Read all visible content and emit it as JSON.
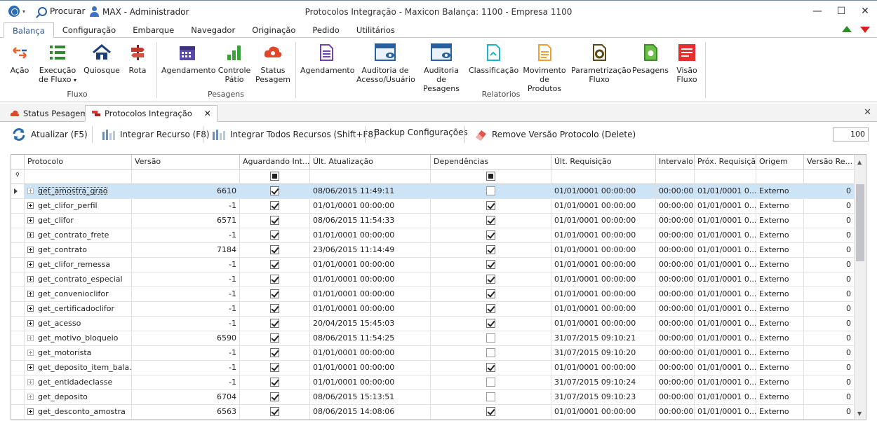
{
  "titlebar": {
    "search_label": "Procurar",
    "user_label": "MAX - Administrador",
    "window_title": "Protocolos Integração - Maxicon Balança: 1100 - Empresa 1100"
  },
  "ribbon_tabs": [
    "Balança",
    "Configuração",
    "Embarque",
    "Navegador",
    "Originação",
    "Pedido",
    "Utilitários"
  ],
  "ribbon": {
    "fluxo": {
      "label": "Fluxo",
      "acao": "Ação",
      "execucao_1": "Execução",
      "execucao_2": "de Fluxo",
      "quiosque": "Quiosque",
      "rota": "Rota"
    },
    "pesagens": {
      "label": "Pesagens",
      "agendamento": "Agendamento",
      "controle_1": "Controle",
      "controle_2": "Pátio",
      "status_1": "Status",
      "status_2": "Pesagem"
    },
    "relatorios": {
      "label": "Relatorios",
      "agendamento": "Agendamento",
      "auditoria_acesso_1": "Auditoria de",
      "auditoria_acesso_2": "Acesso/Usuário",
      "auditoria_pesagens_1": "Auditoria",
      "auditoria_pesagens_2": "de Pesagens",
      "classificacao": "Classificação",
      "movimento_1": "Movimento",
      "movimento_2": "de Produtos",
      "parametrizacao_1": "Parametrização",
      "parametrizacao_2": "Fluxo",
      "pesagens": "Pesagens",
      "visao_1": "Visão",
      "visao_2": "Fluxo"
    }
  },
  "doc_tabs": {
    "status_pesagem": "Status Pesagem",
    "protocolos": "Protocolos Integração"
  },
  "toolbar": {
    "atualizar": "Atualizar (F5)",
    "integrar_recurso": "Integrar Recurso (F8)",
    "integrar_todos": "Integrar Todos Recursos (Shift+F8)",
    "backup": "Backup Configurações",
    "remove": "Remove Versão Protocolo (Delete)",
    "page_size": "100"
  },
  "grid": {
    "columns": [
      "Protocolo",
      "Versão",
      "Aguardando Int...",
      "Últ. Atualização",
      "Dependências",
      "Últ. Requisição",
      "Intervalo",
      "Próx. Requisição",
      "Origem",
      "Versão Re..."
    ],
    "rows": [
      {
        "protocolo": "get_amostra_grao",
        "versao": "6610",
        "aguardando": true,
        "ult_atualizacao": "08/06/2015 11:49:11",
        "dependencias": false,
        "ult_requisicao": "01/01/0001 00:00:00",
        "intervalo": "00:00:00",
        "prox_requisicao": "01/01/0001 0...",
        "origem": "Externo",
        "versao_re": "0",
        "expandable": false
      },
      {
        "protocolo": "get_clifor_perfil",
        "versao": "-1",
        "aguardando": true,
        "ult_atualizacao": "01/01/0001 00:00:00",
        "dependencias": true,
        "ult_requisicao": "01/01/0001 00:00:00",
        "intervalo": "00:00:00",
        "prox_requisicao": "01/01/0001 0...",
        "origem": "Externo",
        "versao_re": "0",
        "expandable": true
      },
      {
        "protocolo": "get_clifor",
        "versao": "6571",
        "aguardando": true,
        "ult_atualizacao": "08/06/2015 11:54:33",
        "dependencias": true,
        "ult_requisicao": "01/01/0001 00:00:00",
        "intervalo": "00:00:00",
        "prox_requisicao": "01/01/0001 0...",
        "origem": "Externo",
        "versao_re": "0",
        "expandable": true
      },
      {
        "protocolo": "get_contrato_frete",
        "versao": "-1",
        "aguardando": true,
        "ult_atualizacao": "01/01/0001 00:00:00",
        "dependencias": true,
        "ult_requisicao": "01/01/0001 00:00:00",
        "intervalo": "00:00:00",
        "prox_requisicao": "01/01/0001 0...",
        "origem": "Externo",
        "versao_re": "0",
        "expandable": true
      },
      {
        "protocolo": "get_contrato",
        "versao": "7184",
        "aguardando": true,
        "ult_atualizacao": "23/06/2015 11:14:49",
        "dependencias": true,
        "ult_requisicao": "01/01/0001 00:00:00",
        "intervalo": "00:00:00",
        "prox_requisicao": "01/01/0001 0...",
        "origem": "Externo",
        "versao_re": "0",
        "expandable": true
      },
      {
        "protocolo": "get_clifor_remessa",
        "versao": "-1",
        "aguardando": true,
        "ult_atualizacao": "01/01/0001 00:00:00",
        "dependencias": true,
        "ult_requisicao": "01/01/0001 00:00:00",
        "intervalo": "00:00:00",
        "prox_requisicao": "01/01/0001 0...",
        "origem": "Externo",
        "versao_re": "0",
        "expandable": true
      },
      {
        "protocolo": "get_contrato_especial",
        "versao": "-1",
        "aguardando": true,
        "ult_atualizacao": "01/01/0001 00:00:00",
        "dependencias": true,
        "ult_requisicao": "01/01/0001 00:00:00",
        "intervalo": "00:00:00",
        "prox_requisicao": "01/01/0001 0...",
        "origem": "Externo",
        "versao_re": "0",
        "expandable": true
      },
      {
        "protocolo": "get_convenioclifor",
        "versao": "-1",
        "aguardando": true,
        "ult_atualizacao": "01/01/0001 00:00:00",
        "dependencias": true,
        "ult_requisicao": "01/01/0001 00:00:00",
        "intervalo": "00:00:00",
        "prox_requisicao": "01/01/0001 0...",
        "origem": "Externo",
        "versao_re": "0",
        "expandable": true
      },
      {
        "protocolo": "get_certificadoclifor",
        "versao": "-1",
        "aguardando": true,
        "ult_atualizacao": "01/01/0001 00:00:00",
        "dependencias": true,
        "ult_requisicao": "01/01/0001 00:00:00",
        "intervalo": "00:00:00",
        "prox_requisicao": "01/01/0001 0...",
        "origem": "Externo",
        "versao_re": "0",
        "expandable": true
      },
      {
        "protocolo": "get_acesso",
        "versao": "-1",
        "aguardando": true,
        "ult_atualizacao": "20/04/2015 15:45:03",
        "dependencias": true,
        "ult_requisicao": "01/01/0001 00:00:00",
        "intervalo": "00:00:00",
        "prox_requisicao": "01/01/0001 0...",
        "origem": "Externo",
        "versao_re": "0",
        "expandable": true
      },
      {
        "protocolo": "get_motivo_bloqueio",
        "versao": "6590",
        "aguardando": true,
        "ult_atualizacao": "08/06/2015 11:54:25",
        "dependencias": false,
        "ult_requisicao": "31/07/2015 09:10:21",
        "intervalo": "00:00:00",
        "prox_requisicao": "01/01/0001 0...",
        "origem": "Externo",
        "versao_re": "0",
        "expandable": false
      },
      {
        "protocolo": "get_motorista",
        "versao": "-1",
        "aguardando": true,
        "ult_atualizacao": "01/01/0001 00:00:00",
        "dependencias": false,
        "ult_requisicao": "31/07/2015 09:10:20",
        "intervalo": "00:00:00",
        "prox_requisicao": "01/01/0001 0...",
        "origem": "Externo",
        "versao_re": "0",
        "expandable": false
      },
      {
        "protocolo": "get_deposito_item_bala...",
        "versao": "-1",
        "aguardando": true,
        "ult_atualizacao": "01/01/0001 00:00:00",
        "dependencias": true,
        "ult_requisicao": "01/01/0001 00:00:00",
        "intervalo": "00:00:00",
        "prox_requisicao": "01/01/0001 0...",
        "origem": "Externo",
        "versao_re": "0",
        "expandable": true
      },
      {
        "protocolo": "get_entidadeclasse",
        "versao": "-1",
        "aguardando": true,
        "ult_atualizacao": "01/01/0001 00:00:00",
        "dependencias": false,
        "ult_requisicao": "31/07/2015 09:10:24",
        "intervalo": "00:00:00",
        "prox_requisicao": "01/01/0001 0...",
        "origem": "Externo",
        "versao_re": "0",
        "expandable": false
      },
      {
        "protocolo": "get_deposito",
        "versao": "6704",
        "aguardando": true,
        "ult_atualizacao": "08/06/2015 15:13:51",
        "dependencias": false,
        "ult_requisicao": "31/07/2015 09:10:23",
        "intervalo": "00:00:00",
        "prox_requisicao": "01/01/0001 0...",
        "origem": "Externo",
        "versao_re": "0",
        "expandable": false
      },
      {
        "protocolo": "get_desconto_amostra",
        "versao": "6563",
        "aguardando": true,
        "ult_atualizacao": "08/06/2015 14:08:06",
        "dependencias": true,
        "ult_requisicao": "01/01/0001 00:00:00",
        "intervalo": "00:00:00",
        "prox_requisicao": "01/01/0001 0...",
        "origem": "Externo",
        "versao_re": "0",
        "expandable": true
      }
    ]
  }
}
